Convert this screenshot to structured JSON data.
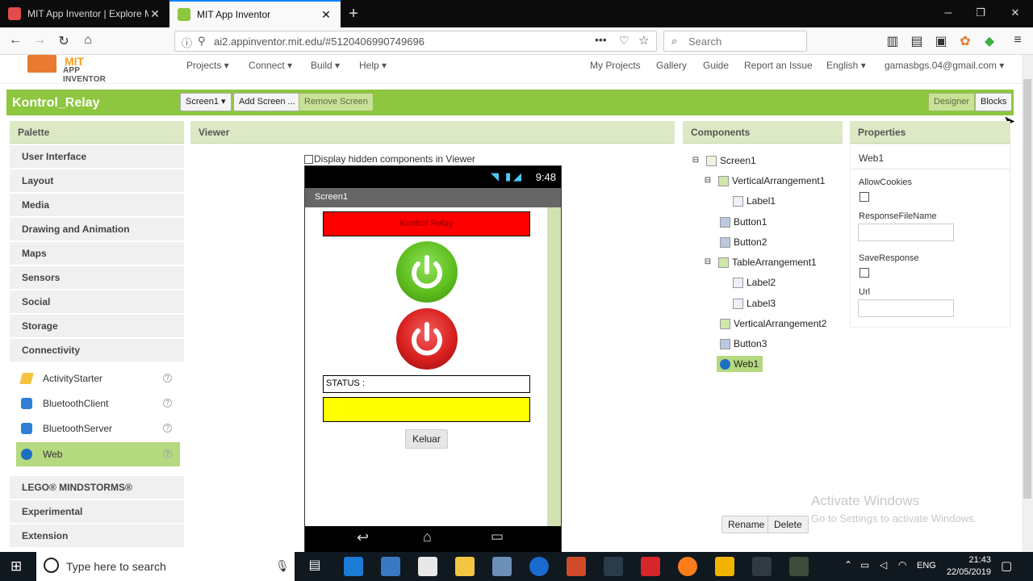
{
  "browser": {
    "tabs": [
      {
        "title": "MIT App Inventor | Explore MIT",
        "active": false
      },
      {
        "title": "MIT App Inventor",
        "active": true
      }
    ],
    "url": "ai2.appinventor.mit.edu/#5120406990749696",
    "search_placeholder": "Search"
  },
  "header": {
    "logo_top": "MIT",
    "logo_sub": "APP INVENTOR",
    "menu_left": [
      "Projects ▾",
      "Connect ▾",
      "Build ▾",
      "Help ▾"
    ],
    "menu_right": [
      "My Projects",
      "Gallery",
      "Guide",
      "Report an Issue",
      "English ▾",
      "gamasbgs.04@gmail.com ▾"
    ]
  },
  "project": {
    "name": "Kontrol_Relay",
    "screen_select": "Screen1 ▾",
    "add_screen": "Add Screen ...",
    "remove_screen": "Remove Screen",
    "designer": "Designer",
    "blocks": "Blocks"
  },
  "palette": {
    "title": "Palette",
    "categories_top": [
      "User Interface",
      "Layout",
      "Media",
      "Drawing and Animation",
      "Maps",
      "Sensors",
      "Social",
      "Storage",
      "Connectivity"
    ],
    "connectivity_items": [
      "ActivityStarter",
      "BluetoothClient",
      "BluetoothServer",
      "Web"
    ],
    "categories_bottom": [
      "LEGO® MINDSTORMS®",
      "Experimental",
      "Extension"
    ],
    "help_glyph": "?"
  },
  "viewer": {
    "title": "Viewer",
    "hidden_label": "Display hidden components in Viewer",
    "time": "9:48",
    "screen_title": "Screen1",
    "label1_text": "Kontrol Relay",
    "status_text": "STATUS :",
    "exit_button": "Keluar"
  },
  "components": {
    "title": "Components",
    "tree": [
      "Screen1",
      "VerticalArrangement1",
      "Label1",
      "Button1",
      "Button2",
      "TableArrangement1",
      "Label2",
      "Label3",
      "VerticalArrangement2",
      "Button3",
      "Web1"
    ],
    "rename": "Rename",
    "delete": "Delete"
  },
  "properties": {
    "title": "Properties",
    "component": "Web1",
    "allow_cookies": "AllowCookies",
    "response_file_name": "ResponseFileName",
    "save_response": "SaveResponse",
    "url": "Url"
  },
  "watermark": {
    "line1": "Activate Windows",
    "line2": "Go to Settings to activate Windows."
  },
  "taskbar": {
    "search_placeholder": "Type here to search",
    "lang": "ENG",
    "time": "21:43",
    "date": "22/05/2019"
  },
  "colors": {
    "app_green": "#8dc63f",
    "panel_head": "#dce9c4",
    "selected_green": "#b5d97e",
    "power_green": "#5fbf1f",
    "power_red": "#d9201f"
  }
}
